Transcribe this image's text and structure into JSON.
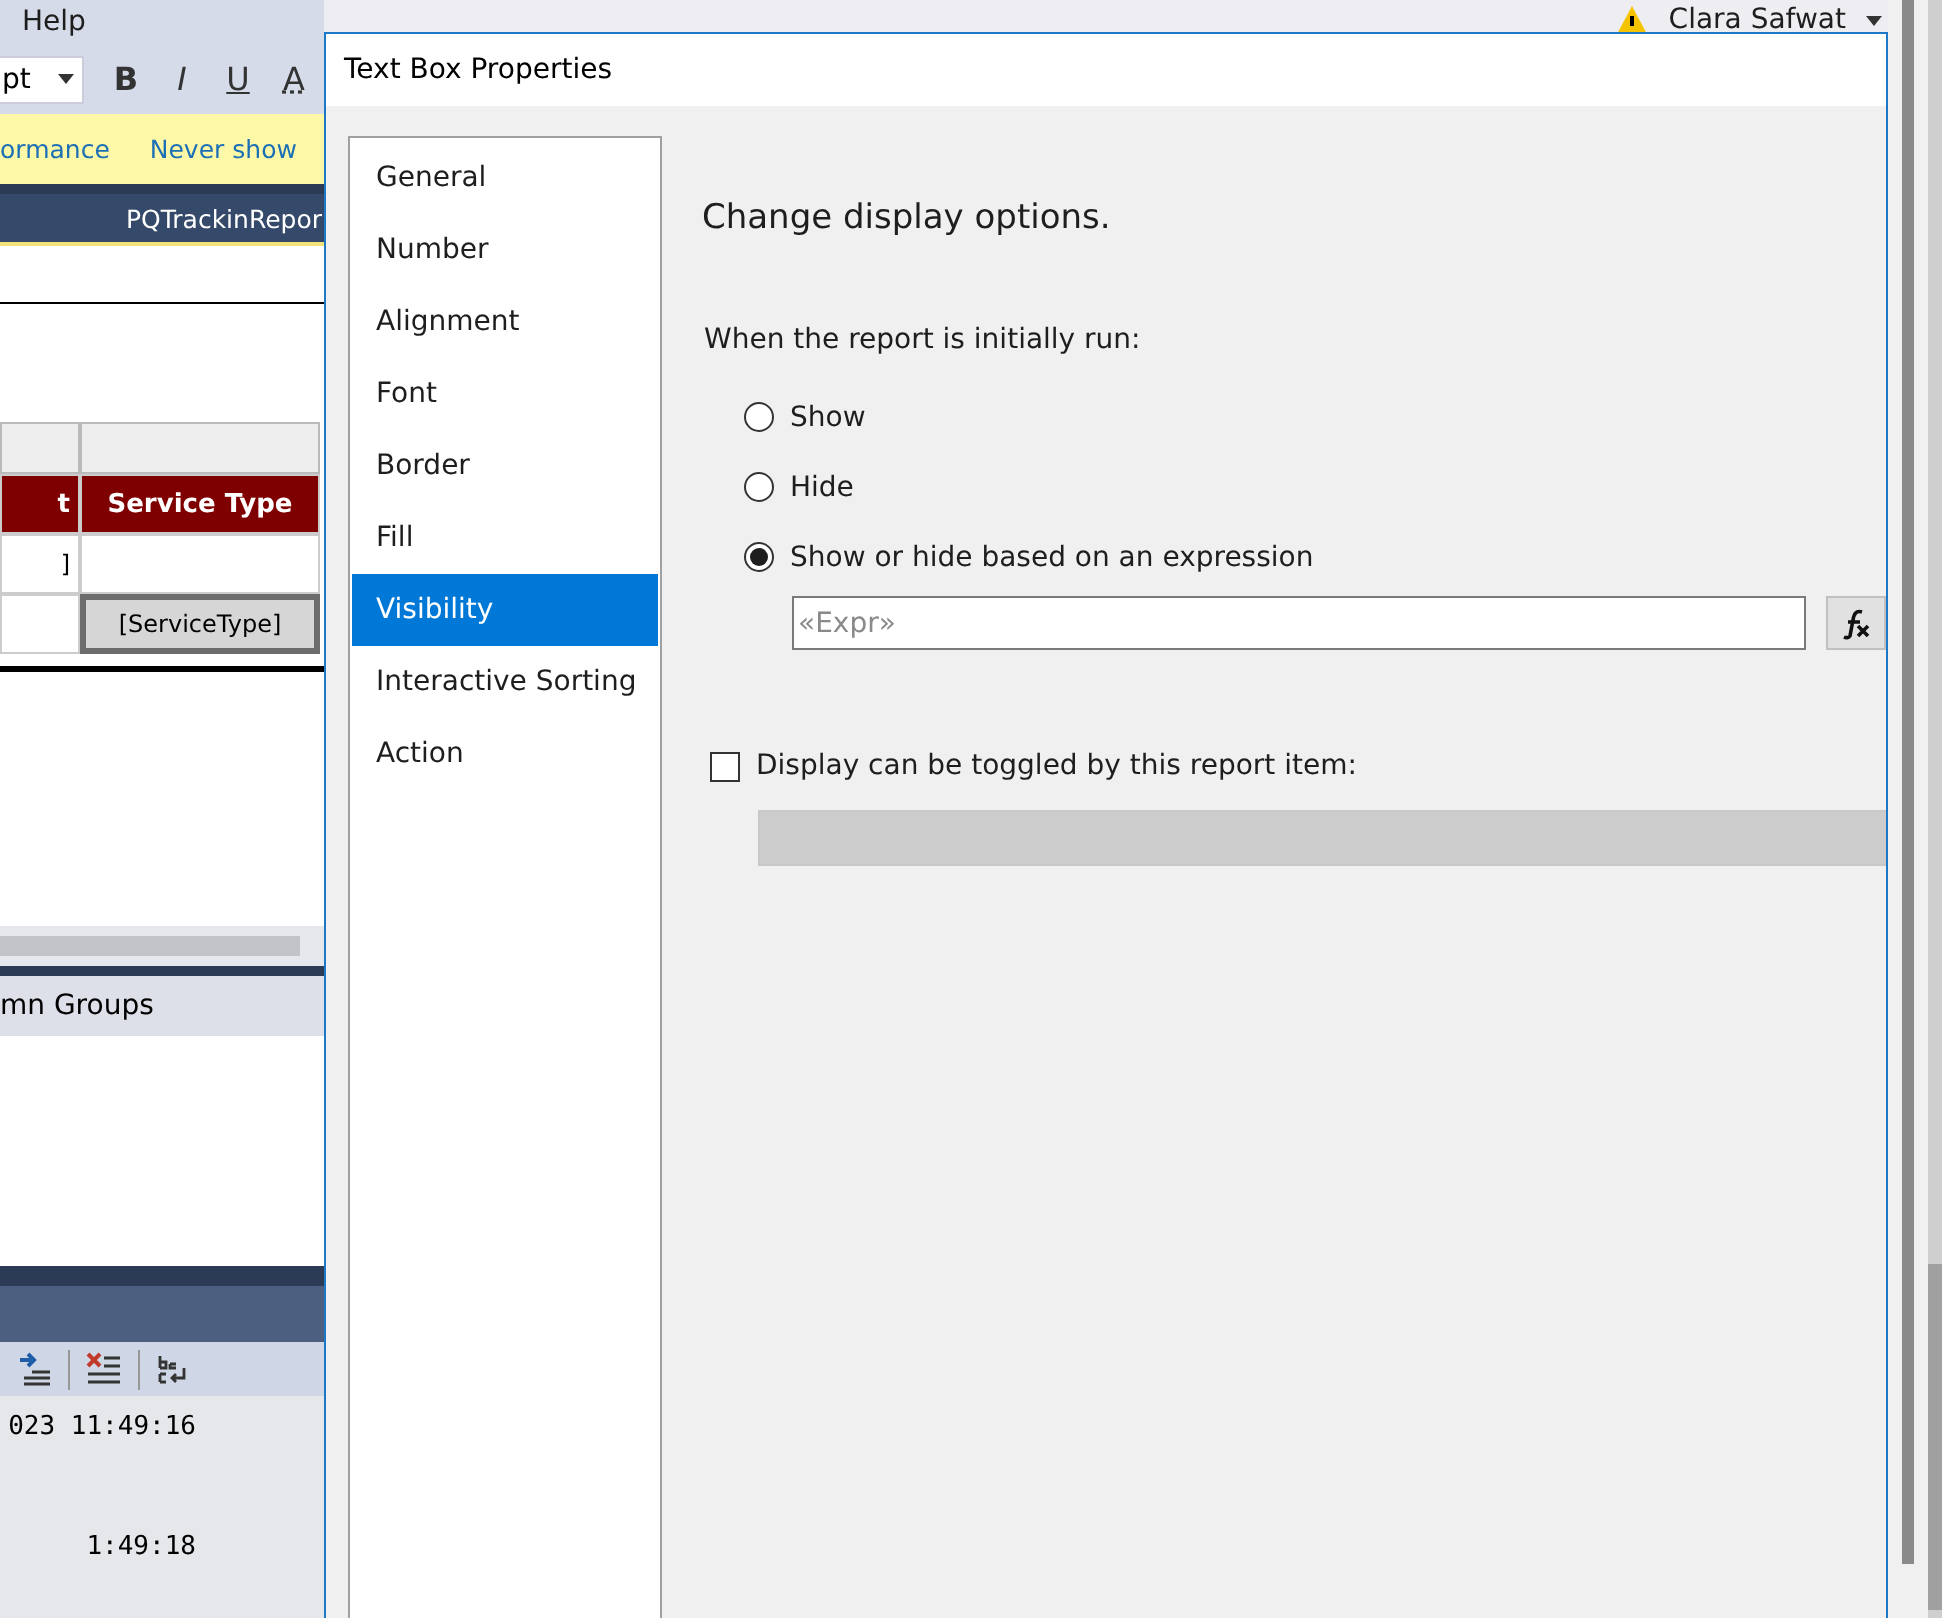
{
  "menu": {
    "items": [
      "Help"
    ],
    "user": "Clara Safwat"
  },
  "toolbar": {
    "font_size": "pt",
    "format_buttons": [
      {
        "label": "B",
        "kind": "bold"
      },
      {
        "label": "I",
        "kind": "italic"
      },
      {
        "label": "U",
        "kind": "underline"
      },
      {
        "label": "A",
        "kind": "color"
      }
    ]
  },
  "info_bar": {
    "texts": [
      "ormance",
      "Never show"
    ]
  },
  "document_tab": {
    "title": "PQTrackinRepor"
  },
  "report_table": {
    "header": [
      "t",
      "Service Type"
    ],
    "rows": [
      {
        "cells": [
          "]",
          ""
        ],
        "selected": false
      },
      {
        "cells": [
          "",
          "[ServiceType]"
        ],
        "selected": true
      }
    ]
  },
  "groups_pane": {
    "title": "mn Groups"
  },
  "output": {
    "lines": [
      "023 11:49:16",
      "1:49:18"
    ]
  },
  "dialog": {
    "title": "Text Box Properties",
    "nav": [
      {
        "label": "General",
        "selected": false
      },
      {
        "label": "Number",
        "selected": false
      },
      {
        "label": "Alignment",
        "selected": false
      },
      {
        "label": "Font",
        "selected": false
      },
      {
        "label": "Border",
        "selected": false
      },
      {
        "label": "Fill",
        "selected": false
      },
      {
        "label": "Visibility",
        "selected": true
      },
      {
        "label": "Interactive Sorting",
        "selected": false
      },
      {
        "label": "Action",
        "selected": false
      }
    ],
    "heading": "Change display options.",
    "prompt": "When the report is initially run:",
    "options": [
      {
        "label": "Show",
        "selected": false
      },
      {
        "label": "Hide",
        "selected": false
      },
      {
        "label": "Show or hide based on an expression",
        "selected": true
      }
    ],
    "expression": {
      "placeholder": "«Expr»"
    },
    "toggle": {
      "label": "Display can be toggled by this report item:",
      "checked": false,
      "disabled": true
    }
  }
}
